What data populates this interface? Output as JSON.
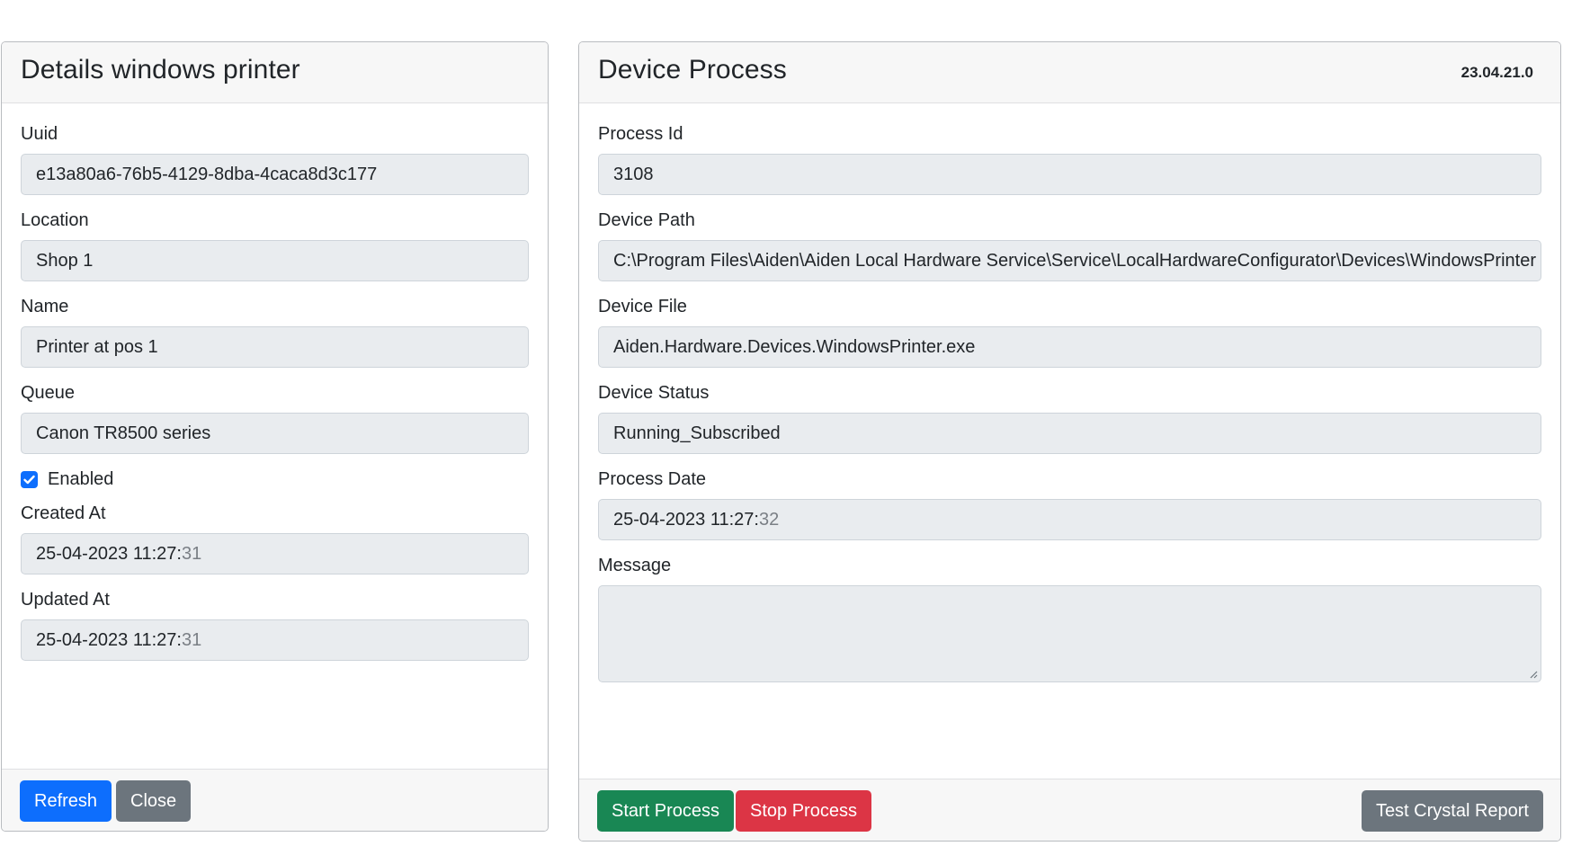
{
  "left_card": {
    "title": "Details windows printer",
    "fields": {
      "uuid": {
        "label": "Uuid",
        "value": "e13a80a6-76b5-4129-8dba-4caca8d3c177"
      },
      "location": {
        "label": "Location",
        "value": "Shop 1"
      },
      "name": {
        "label": "Name",
        "value": "Printer at pos 1"
      },
      "queue": {
        "label": "Queue",
        "value": "Canon TR8500 series"
      },
      "created_at": {
        "label": "Created At",
        "value_main": "25-04-2023 11:27:",
        "value_seconds": "31"
      },
      "updated_at": {
        "label": "Updated At",
        "value_main": "25-04-2023 11:27:",
        "value_seconds": "31"
      }
    },
    "enabled": {
      "label": "Enabled",
      "checked": true
    },
    "buttons": {
      "refresh": "Refresh",
      "close": "Close"
    }
  },
  "right_card": {
    "title": "Device Process",
    "version": "23.04.21.0",
    "fields": {
      "process_id": {
        "label": "Process Id",
        "value": "3108"
      },
      "device_path": {
        "label": "Device Path",
        "value": "C:\\Program Files\\Aiden\\Aiden Local Hardware Service\\Service\\LocalHardwareConfigurator\\Devices\\WindowsPrinter"
      },
      "device_file": {
        "label": "Device File",
        "value": "Aiden.Hardware.Devices.WindowsPrinter.exe"
      },
      "device_status": {
        "label": "Device Status",
        "value": "Running_Subscribed"
      },
      "process_date": {
        "label": "Process Date",
        "value_main": "25-04-2023 11:27:",
        "value_seconds": "32"
      },
      "message": {
        "label": "Message",
        "value": ""
      }
    },
    "buttons": {
      "start": "Start Process",
      "stop": "Stop Process",
      "test_report": "Test Crystal Report"
    }
  },
  "colors": {
    "primary": "#0d6efd",
    "secondary": "#6c757d",
    "success": "#198754",
    "danger": "#dc3545",
    "input_bg": "#e9ecef"
  },
  "icons": {
    "checkbox": "checkmark-icon",
    "textarea": "resize-grip-icon"
  }
}
